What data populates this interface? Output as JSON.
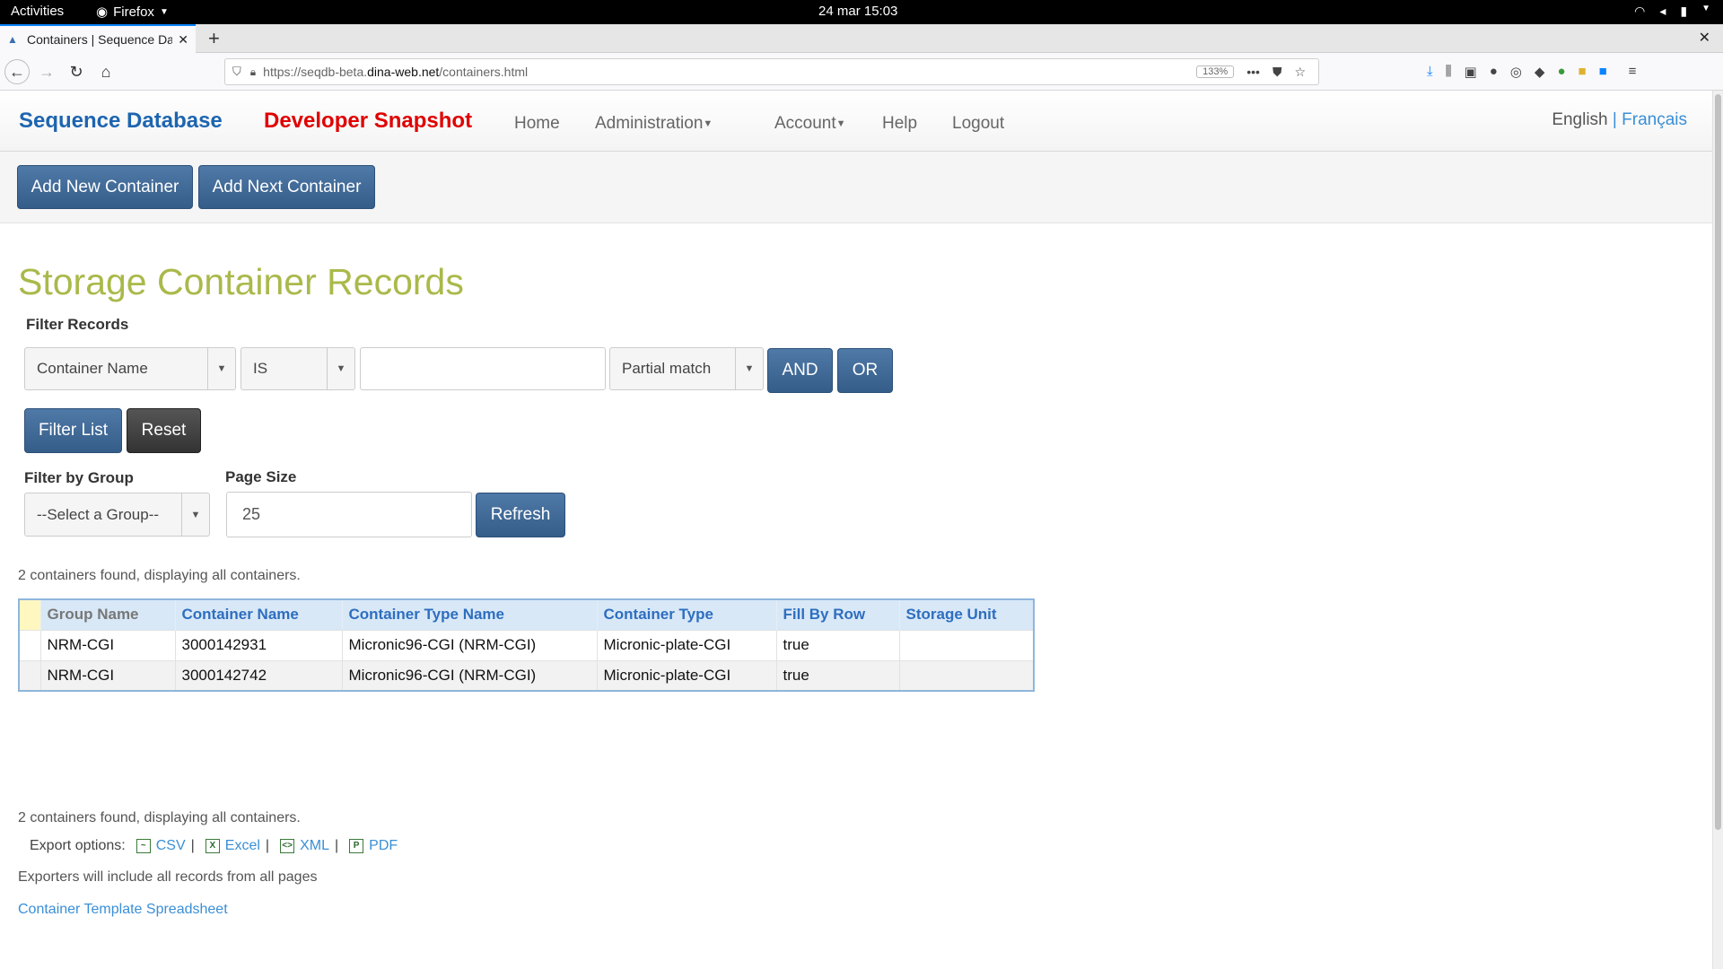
{
  "os_bar": {
    "activities": "Activities",
    "app": "Firefox",
    "clock": "24 mar  15:03"
  },
  "browser": {
    "tab_title": "Containers | Sequence Da",
    "url_prefix": "https://seqdb-beta.",
    "url_host": "dina-web.net",
    "url_path": "/containers.html",
    "zoom": "133%"
  },
  "site_nav": {
    "brand": "Sequence Database",
    "snapshot": "Developer Snapshot",
    "home": "Home",
    "administration": "Administration",
    "account": "Account",
    "help": "Help",
    "logout": "Logout",
    "lang_en": "English",
    "lang_sep": "|",
    "lang_fr": "Français"
  },
  "actions": {
    "add_new": "Add New Container",
    "add_next": "Add Next Container"
  },
  "page": {
    "title": "Storage Container Records",
    "filter_records": "Filter Records",
    "filter_field": "Container Name",
    "filter_operator": "IS",
    "filter_value": "",
    "filter_match": "Partial match",
    "and_label": "AND",
    "or_label": "OR",
    "filter_list": "Filter List",
    "reset": "Reset",
    "filter_by_group": "Filter by Group",
    "group_select": "--Select a Group--",
    "page_size_label": "Page Size",
    "page_size_value": "25",
    "refresh": "Refresh",
    "status_top": "2 containers found, displaying all containers.",
    "status_bottom": "2 containers found, displaying all containers.",
    "export_label": "Export options:",
    "export_csv": "CSV",
    "export_excel": "Excel",
    "export_xml": "XML",
    "export_pdf": "PDF",
    "export_sep": "|",
    "exporters_note": "Exporters will include all records from all pages",
    "template_link": "Container Template Spreadsheet"
  },
  "table": {
    "columns": [
      "Group Name",
      "Container Name",
      "Container Type Name",
      "Container Type",
      "Fill By Row",
      "Storage Unit"
    ],
    "rows": [
      [
        "NRM-CGI",
        "3000142931",
        "Micronic96-CGI (NRM-CGI)",
        "Micronic-plate-CGI",
        "true",
        ""
      ],
      [
        "NRM-CGI",
        "3000142742",
        "Micronic96-CGI (NRM-CGI)",
        "Micronic-plate-CGI",
        "true",
        ""
      ]
    ]
  },
  "colors": {
    "brand_blue": "#1d65b0",
    "snapshot_red": "#e00000",
    "title_olive": "#aab94a",
    "button_blue": "#355d89"
  }
}
